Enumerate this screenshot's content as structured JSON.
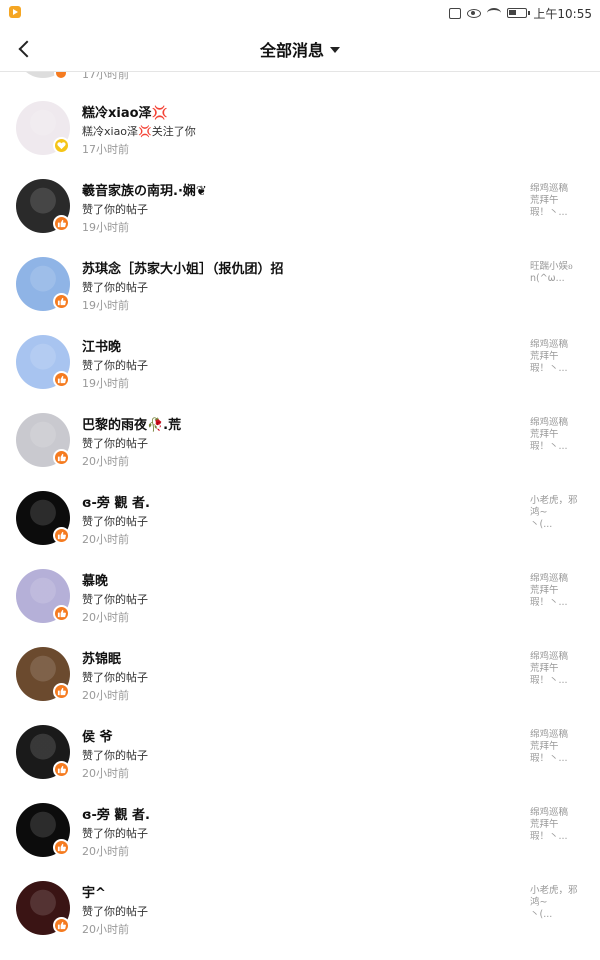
{
  "status_bar": {
    "time": "上午10:55",
    "icons": [
      "app-icon",
      "vibrate-icon",
      "eye-icon",
      "wifi-icon",
      "battery-icon"
    ]
  },
  "header": {
    "title": "全部消息",
    "back_icon": "back-arrow-icon",
    "dropdown_icon": "caret-down-icon"
  },
  "partial_item": {
    "time": "17小时前"
  },
  "colors": {
    "like_badge": "#f57b20",
    "follow_badge": "#f5c518",
    "time_text": "#999999"
  },
  "notifications": [
    {
      "name": "糕冷xiao泽💢",
      "action": "糕冷xiao泽💢关注了你",
      "time": "17小时前",
      "snippet": "",
      "badge": "heart",
      "avatar_color": "#efe9ee"
    },
    {
      "name": "羲音家族の南玥.·娴❦",
      "action": "赞了你的帖子",
      "time": "19小时前",
      "snippet": "绵鸡巡稿\n荒拜午\n瑕！丶...",
      "badge": "like",
      "avatar_color": "#2a2a2a"
    },
    {
      "name": "苏琪念［苏家大小姐］（报仇团）招",
      "action": "赞了你的帖子",
      "time": "19小时前",
      "snippet": "旺踹小娱ᦈ\nn(^ω...",
      "badge": "like",
      "avatar_color": "#8fb4e6"
    },
    {
      "name": "江书晚",
      "action": "赞了你的帖子",
      "time": "19小时前",
      "snippet": "绵鸡巡稿\n荒拜午\n瑕！丶...",
      "badge": "like",
      "avatar_color": "#a8c4f0"
    },
    {
      "name": "巴黎的雨夜🥀.荒",
      "action": "赞了你的帖子",
      "time": "20小时前",
      "snippet": "绵鸡巡稿\n荒拜午\n瑕！丶...",
      "badge": "like",
      "avatar_color": "#c9c9cf"
    },
    {
      "name": "ɞ-旁 觀 者.",
      "action": "赞了你的帖子",
      "time": "20小时前",
      "snippet": "小老虎，邪\n鸿~\n丶(...",
      "badge": "like",
      "avatar_color": "#0c0c0c"
    },
    {
      "name": "慕晚",
      "action": "赞了你的帖子",
      "time": "20小时前",
      "snippet": "绵鸡巡稿\n荒拜午\n瑕！丶...",
      "badge": "like",
      "avatar_color": "#b5b0d8"
    },
    {
      "name": "苏锦眠",
      "action": "赞了你的帖子",
      "time": "20小时前",
      "snippet": "绵鸡巡稿\n荒拜午\n瑕！丶...",
      "badge": "like",
      "avatar_color": "#6b4a2e"
    },
    {
      "name": "侯 爷",
      "action": "赞了你的帖子",
      "time": "20小时前",
      "snippet": "绵鸡巡稿\n荒拜午\n瑕！丶...",
      "badge": "like",
      "avatar_color": "#1a1a1a"
    },
    {
      "name": "ɞ-旁 觀 者.",
      "action": "赞了你的帖子",
      "time": "20小时前",
      "snippet": "绵鸡巡稿\n荒拜午\n瑕！丶...",
      "badge": "like",
      "avatar_color": "#0c0c0c"
    },
    {
      "name": "宇^",
      "action": "赞了你的帖子",
      "time": "20小时前",
      "snippet": "小老虎，邪\n鸿~\n丶(...",
      "badge": "like",
      "avatar_color": "#3a1414"
    }
  ]
}
